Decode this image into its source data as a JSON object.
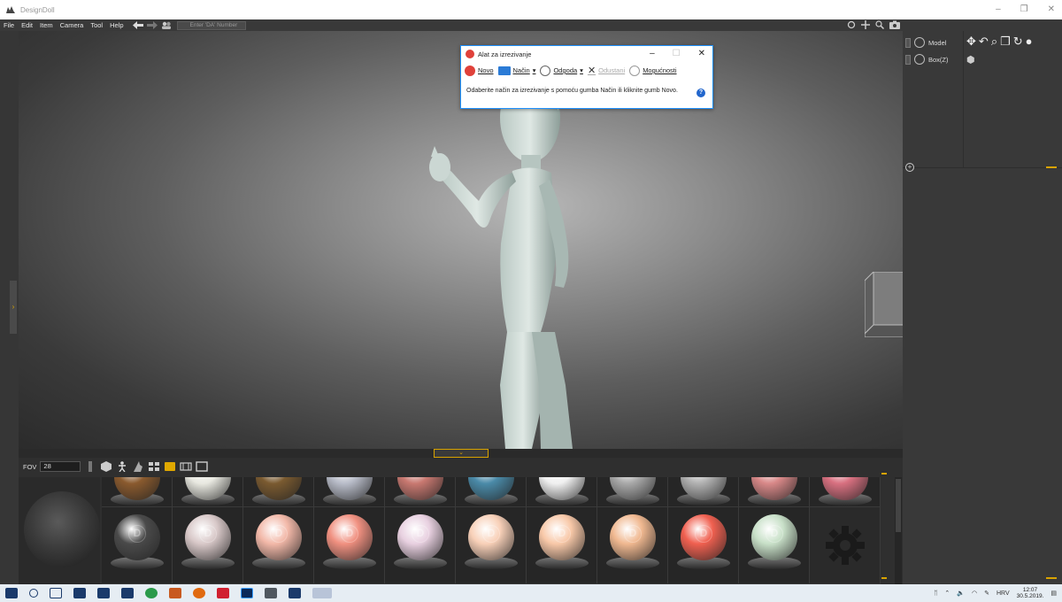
{
  "app": {
    "title": "DesignDoll"
  },
  "menu": {
    "items": [
      "File",
      "Edit",
      "Item",
      "Camera",
      "Tool",
      "Help"
    ],
    "search_placeholder": "Enter 'DA' Number"
  },
  "window_controls": {
    "minimize": "–",
    "restore": "❐",
    "close": "✕"
  },
  "snipping_dialog": {
    "title": "Alat za izrezivanje",
    "new_label": "Novo",
    "mode_label": "Način",
    "delay_label": "Odgoda",
    "cancel_label": "Odustani",
    "options_label": "Mogućnosti",
    "message": "Odaberite način za izrezivanje s pomoću gumba Način ili kliknite gumb Novo.",
    "help": "?"
  },
  "toolbar": {
    "fov_label": "FOV",
    "fov_value": "28"
  },
  "right_panel": {
    "items": [
      {
        "label": "Model"
      },
      {
        "label": "Box(Z)"
      }
    ]
  },
  "materials": {
    "row1_colors": [
      "#8a5a2e",
      "#e8e8e0",
      "#7a5a30",
      "#b8bcc8",
      "#c87870",
      "#4a8aa8",
      "#f0f0f0",
      "#a8a8a8",
      "#b0b0b0",
      "#d88888",
      "#d87080"
    ],
    "row2_colors": [
      "#4a4a4a",
      "#d8c8c8",
      "#f2b8a8",
      "#f09080",
      "#e8d0e0",
      "#f8d0b8",
      "#f8c8a8",
      "#f0b890",
      "#f06050",
      "#c8e0c8",
      "gear"
    ]
  },
  "taskbar": {
    "language": "HRV",
    "time": "12:07",
    "date": "30.5.2019."
  }
}
